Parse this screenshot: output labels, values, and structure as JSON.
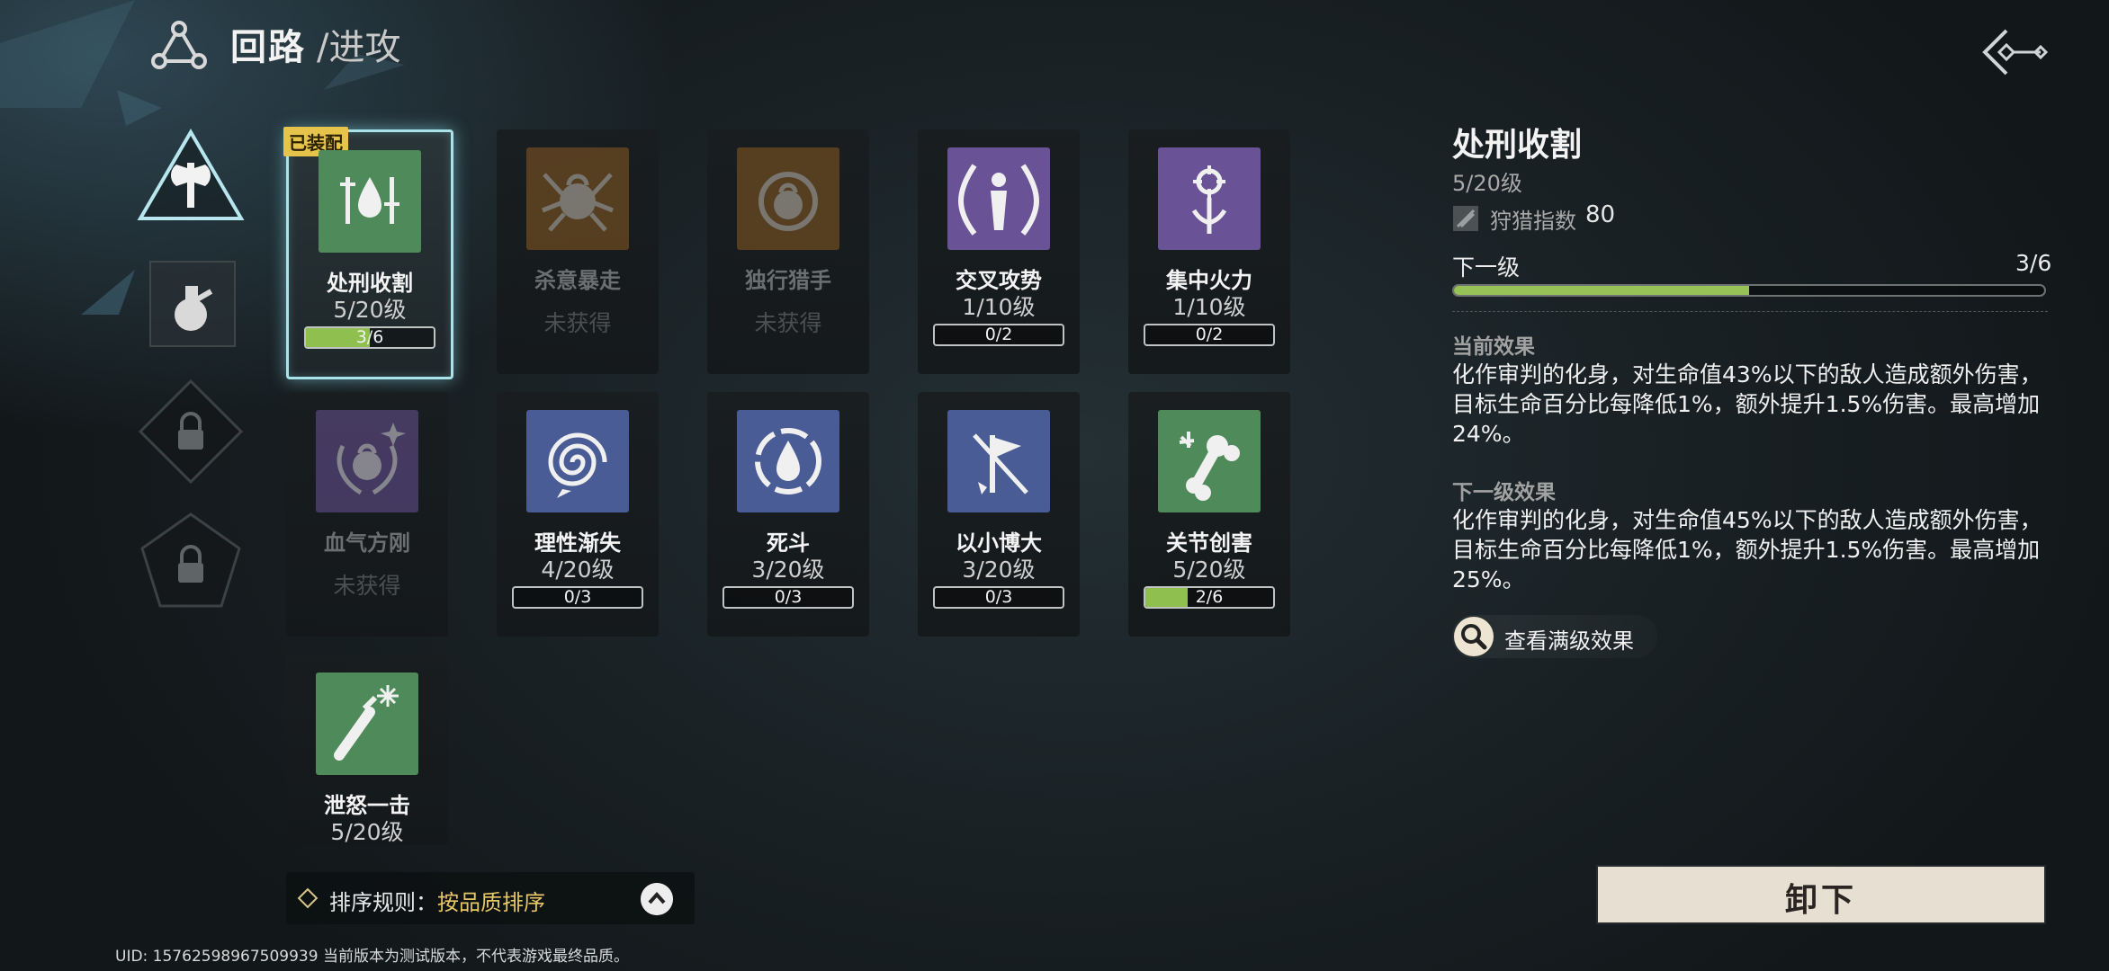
{
  "header": {
    "title": "回路",
    "subtitle": "/进攻"
  },
  "rail": [
    {
      "id": "axe",
      "icon": "axe-icon"
    },
    {
      "id": "potion",
      "icon": "potion-icon"
    },
    {
      "id": "locked-1",
      "icon": "lock-icon"
    },
    {
      "id": "locked-2",
      "icon": "lock-icon"
    }
  ],
  "cards": [
    {
      "name": "处刑收割",
      "level": "5/20级",
      "progress": "3/6",
      "fill": 0.5,
      "equipped_tag": "已装配",
      "color": "#4f8a5a"
    },
    {
      "name": "杀意暴走",
      "status": "未获得",
      "color": "#8a5a24"
    },
    {
      "name": "独行猎手",
      "status": "未获得",
      "color": "#8a5a24"
    },
    {
      "name": "交叉攻势",
      "level": "1/10级",
      "progress": "0/2",
      "fill": 0,
      "color": "#6a5296"
    },
    {
      "name": "集中火力",
      "level": "1/10级",
      "progress": "0/2",
      "fill": 0,
      "color": "#6a5296"
    },
    {
      "name": "血气方刚",
      "status": "未获得",
      "color": "#6a5296"
    },
    {
      "name": "理性渐失",
      "level": "4/20级",
      "progress": "0/3",
      "fill": 0,
      "color": "#4a5c95"
    },
    {
      "name": "死斗",
      "level": "3/20级",
      "progress": "0/3",
      "fill": 0,
      "color": "#4a5c95"
    },
    {
      "name": "以小博大",
      "level": "3/20级",
      "progress": "0/3",
      "fill": 0,
      "color": "#4a5c95"
    },
    {
      "name": "关节创害",
      "level": "5/20级",
      "progress": "2/6",
      "fill": 0.333,
      "color": "#4f8a5a"
    },
    {
      "name": "泄怒一击",
      "level": "5/20级",
      "color": "#4f8a5a"
    }
  ],
  "detail": {
    "title": "处刑收割",
    "level": "5/20级",
    "hunt_label": "狩猎指数",
    "hunt_value": "80",
    "next_label": "下一级",
    "next_value": "3/6",
    "next_fill": 0.5,
    "current_heading": "当前效果",
    "current_text": "化作审判的化身，对生命值43%以下的敌人造成额外伤害，目标生命百分比每降低1%，额外提升1.5%伤害。最高增加24%。",
    "next_heading": "下一级效果",
    "next_text": "化作审判的化身，对生命值45%以下的敌人造成额外伤害，目标生命百分比每降低1%，额外提升1.5%伤害。最高增加25%。",
    "full_effect": "查看满级效果"
  },
  "unequip_label": "卸下",
  "sort": {
    "label": "排序规则：",
    "value": "按品质排序"
  },
  "footer": "UID: 15762598967509939 当前版本为测试版本，不代表游戏最终品质。"
}
